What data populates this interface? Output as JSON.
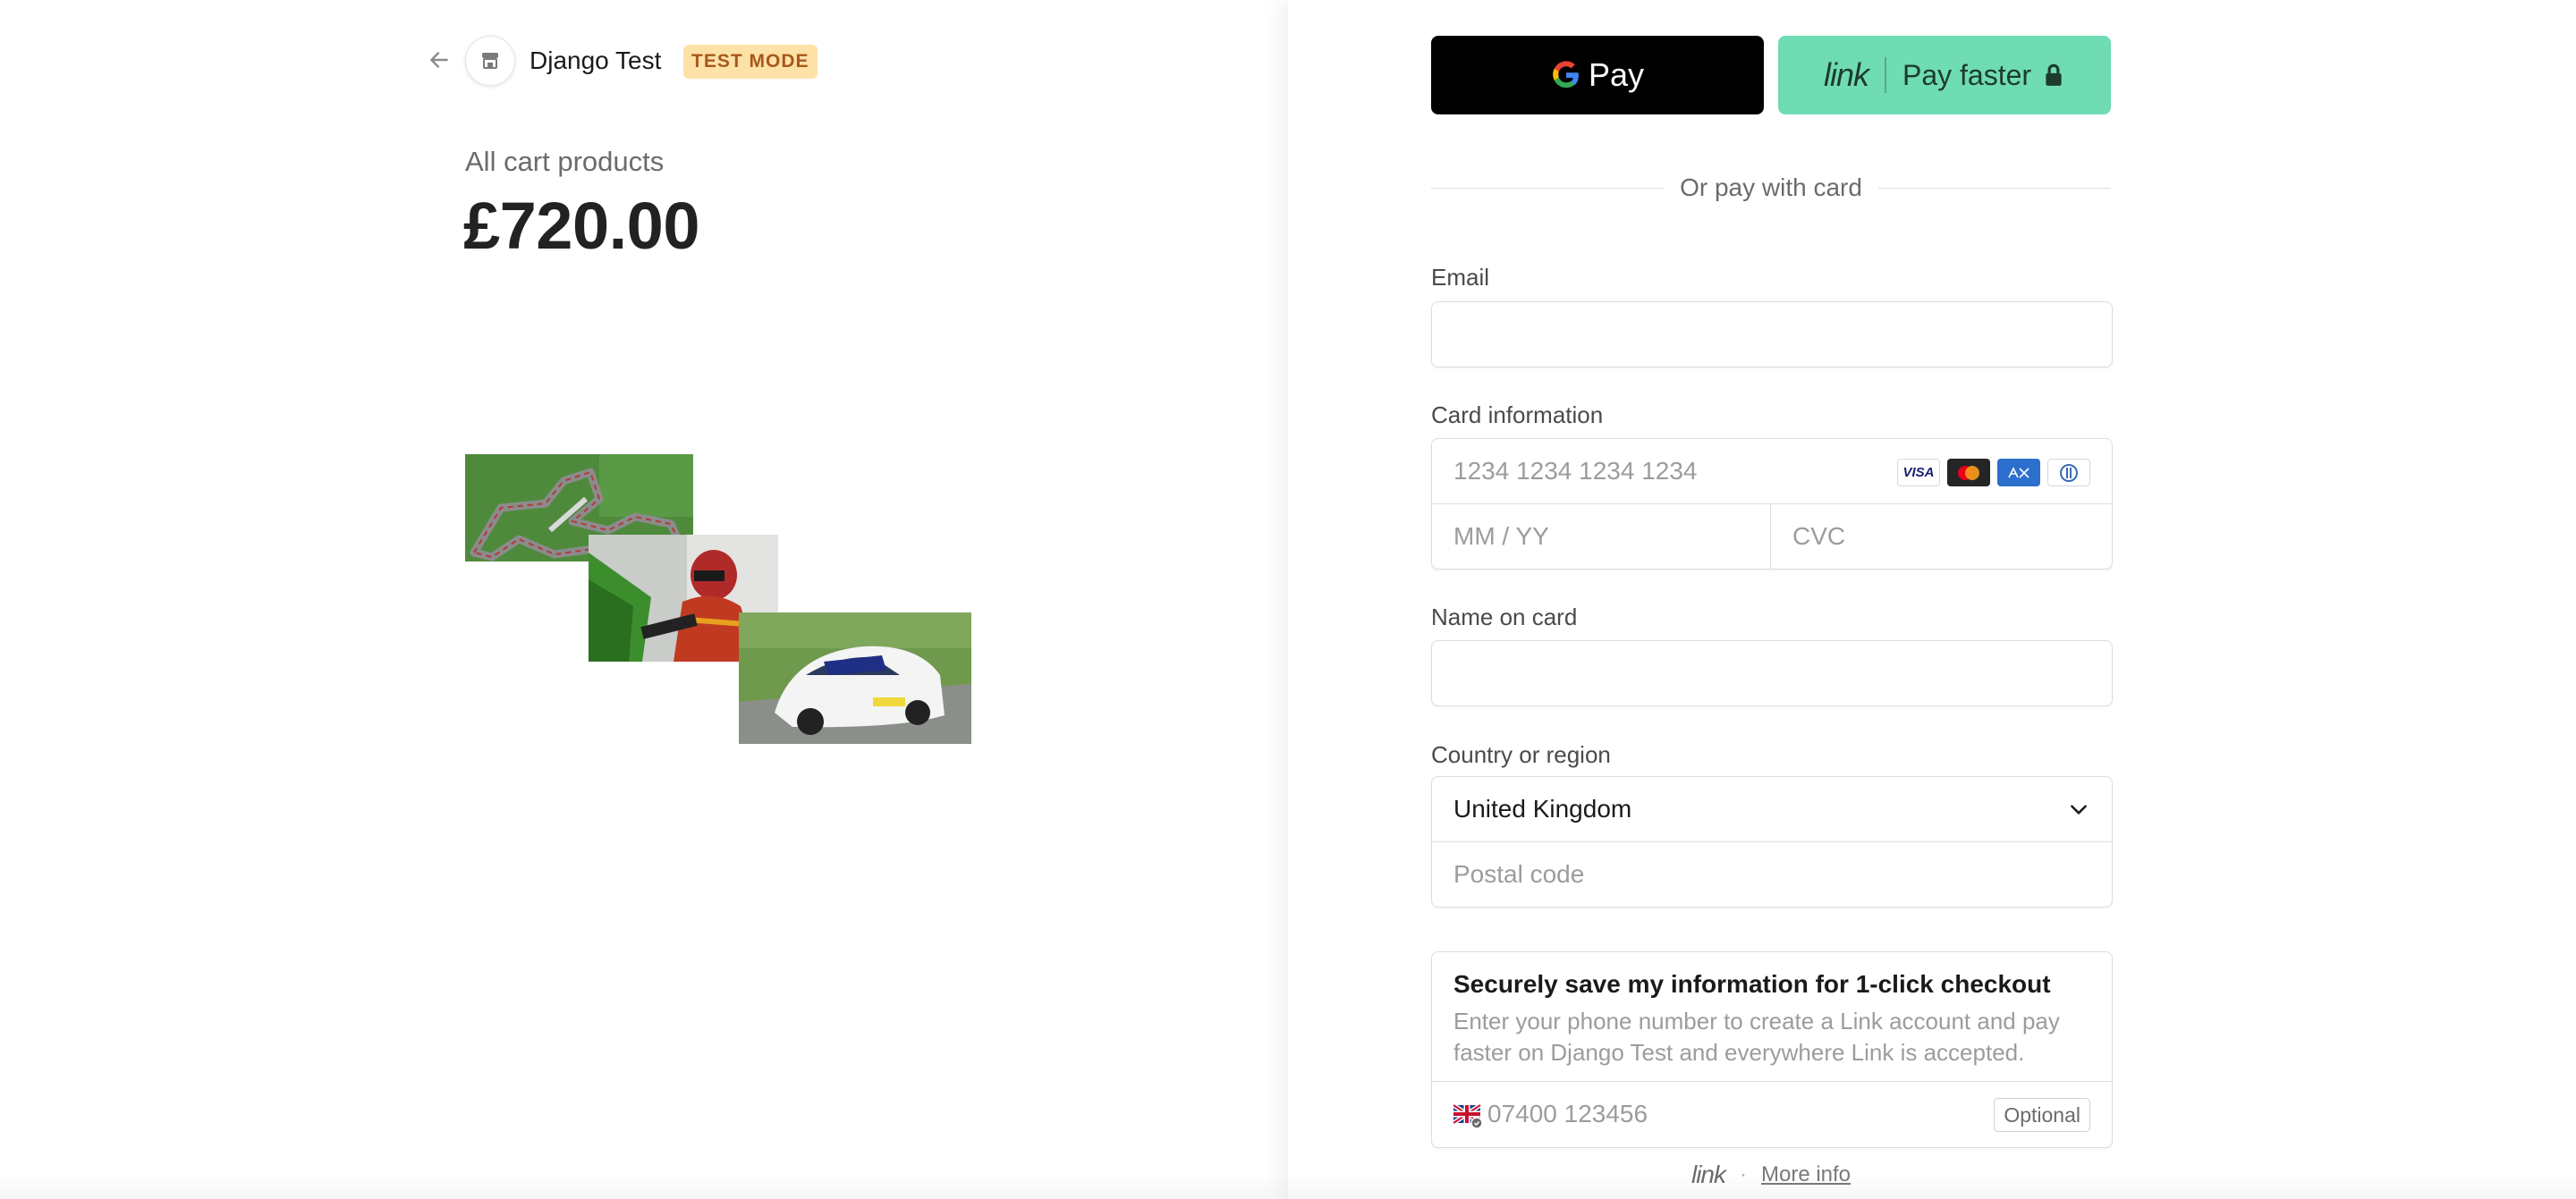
{
  "merchant": {
    "name": "Django Test",
    "mode_badge": "TEST MODE"
  },
  "summary": {
    "label": "All cart products",
    "total": "£720.00"
  },
  "icons": {
    "back": "arrow-left-icon",
    "store": "store-icon",
    "lock": "lock-icon",
    "chevron": "chevron-down-icon",
    "flag": "uk-flag-icon"
  },
  "wallets": {
    "gpay_label": "Pay",
    "link_word": "link",
    "link_label": "Pay faster"
  },
  "divider_text": "Or pay with card",
  "form": {
    "email_label": "Email",
    "email_value": "",
    "card_label": "Card information",
    "card_number_placeholder": "1234 1234 1234 1234",
    "expiry_placeholder": "MM / YY",
    "cvc_placeholder": "CVC",
    "card_brands": [
      "VISA",
      "Mastercard",
      "AMEX",
      "Diners"
    ],
    "name_label": "Name on card",
    "name_value": "",
    "country_label": "Country or region",
    "country_value": "United Kingdom",
    "postal_placeholder": "Postal code"
  },
  "save": {
    "title": "Securely save my information for 1-click checkout",
    "description": "Enter your phone number to create a Link account and pay faster on Django Test and everywhere Link is accepted.",
    "phone_placeholder": "07400 123456",
    "optional_label": "Optional"
  },
  "footer": {
    "link_word": "link",
    "separator": "·",
    "more_info": "More info"
  },
  "colors": {
    "accent_link": "#6fdcb3",
    "badge_bg": "#fde2a8",
    "badge_text": "#a8581b"
  }
}
